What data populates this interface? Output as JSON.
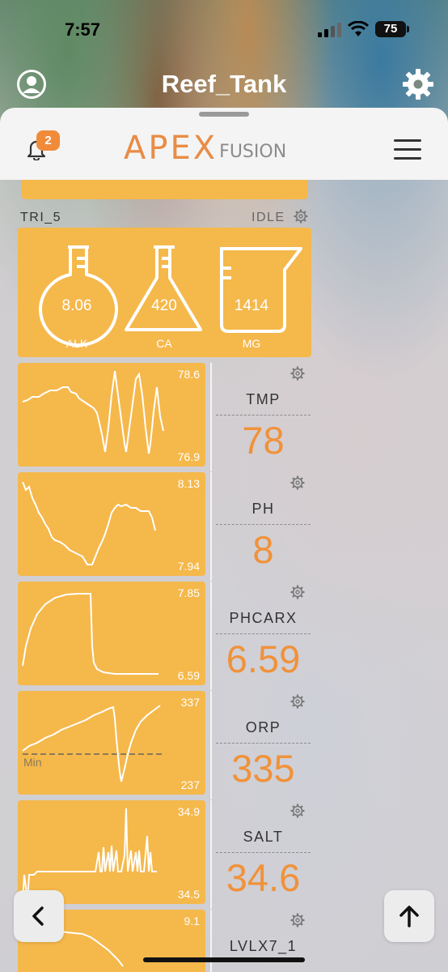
{
  "status_bar": {
    "time": "7:57",
    "battery": "75"
  },
  "title_bar": {
    "title": "Reef_Tank"
  },
  "header": {
    "notification_count": "2",
    "logo_main": "APEX",
    "logo_sub": "FUSION"
  },
  "trident": {
    "name": "TRI_5",
    "status": "IDLE",
    "alk": {
      "value": "8.06",
      "label": "ALK"
    },
    "ca": {
      "value": "420",
      "label": "CA"
    },
    "mg": {
      "value": "1414",
      "label": "MG"
    }
  },
  "probes": [
    {
      "name": "TMP",
      "value": "78",
      "graph_max": "78.6",
      "graph_min": "76.9"
    },
    {
      "name": "PH",
      "value": "8",
      "graph_max": "8.13",
      "graph_min": "7.94"
    },
    {
      "name": "PHCARX",
      "value": "6.59",
      "graph_max": "7.85",
      "graph_min": "6.59"
    },
    {
      "name": "ORP",
      "value": "335",
      "graph_max": "337",
      "graph_min": "237",
      "threshold_label": "Min"
    },
    {
      "name": "SALT",
      "value": "34.6",
      "graph_max": "34.9",
      "graph_min": "34.5"
    },
    {
      "name": "LVLX7_1",
      "value": "",
      "graph_max": "9.1",
      "graph_min": ""
    }
  ],
  "colors": {
    "tile": "#f5b84b",
    "value_orange": "#f0923a",
    "badge": "#f08b3a"
  },
  "icons": [
    "profile-icon",
    "gear-icon",
    "bell-icon",
    "menu-icon",
    "back-arrow-icon",
    "scroll-up-icon"
  ]
}
